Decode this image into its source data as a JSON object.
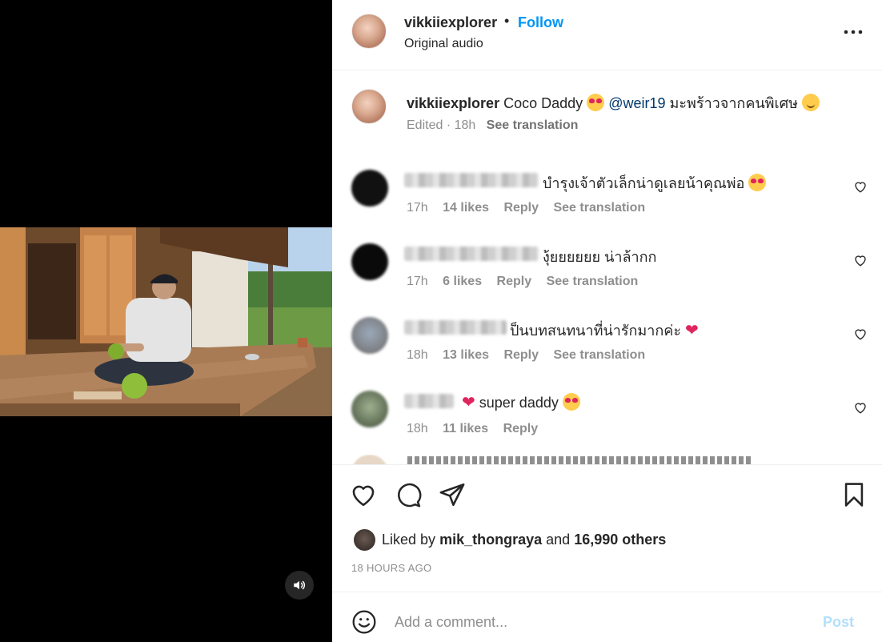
{
  "header": {
    "username": "vikkiiexplorer",
    "separator": "•",
    "follow_label": "Follow",
    "audio_label": "Original audio"
  },
  "caption": {
    "username": "vikkiiexplorer",
    "text_part1": "Coco Daddy",
    "mention": "@weir19",
    "text_part2": "มะพร้าวจากคนพิเศษ",
    "edited_label": "Edited",
    "separator": "·",
    "time": "18h",
    "see_translation": "See translation"
  },
  "comments": [
    {
      "text": "บำรุงเจ้าตัวเล็กน่าดูเลยน้าคุณพ่อ",
      "time": "17h",
      "likes": "14 likes",
      "reply": "Reply",
      "see_translation": "See translation",
      "avatar_color": "#111111"
    },
    {
      "text": "งุ้ยยยยยย น่าล้ากก",
      "time": "17h",
      "likes": "6 likes",
      "reply": "Reply",
      "see_translation": "See translation",
      "avatar_color": "#0a0a0a"
    },
    {
      "text": "ป็นบทสนทนาที่น่ารักมากค่ะ",
      "time": "18h",
      "likes": "13 likes",
      "reply": "Reply",
      "see_translation": "See translation",
      "avatar_color": "#8f8a8a"
    },
    {
      "text": "super daddy",
      "time": "18h",
      "likes": "11 likes",
      "reply": "Reply",
      "avatar_color": "#7d8b73"
    }
  ],
  "likes": {
    "prefix": "Liked by",
    "user": "mik_thongraya",
    "and": "and",
    "others": "16,990 others"
  },
  "timestamp": "18 HOURS AGO",
  "add_comment": {
    "placeholder": "Add a comment...",
    "post_label": "Post"
  },
  "icons": {
    "more": "more-horizontal-icon",
    "heart": "heart-outline-icon",
    "comment": "comment-bubble-icon",
    "share": "send-icon",
    "save": "bookmark-icon",
    "mute": "speaker-icon",
    "emoji": "smiley-icon"
  },
  "colors": {
    "accent": "#0095f6",
    "mention": "#00376b",
    "post_disabled": "#b2dffc",
    "heart_red": "#e0245e"
  }
}
